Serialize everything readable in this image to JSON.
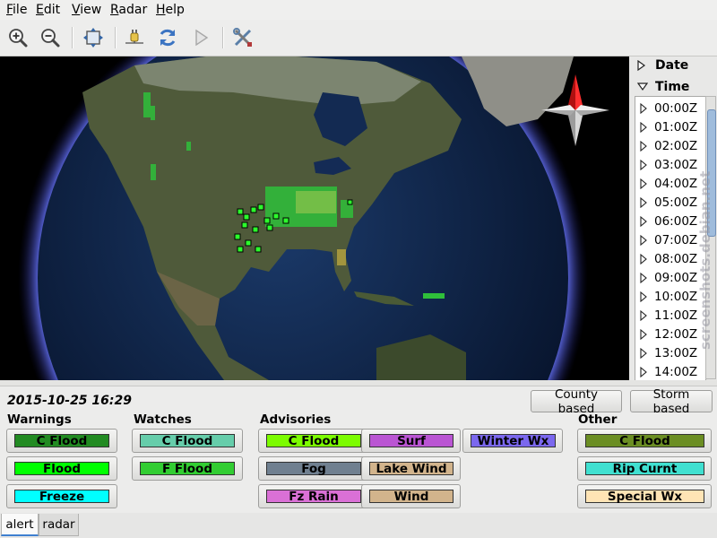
{
  "menubar": {
    "file": "File",
    "edit": "Edit",
    "view": "View",
    "radar": "Radar",
    "help": "Help"
  },
  "sidebar": {
    "date_label": "Date",
    "time_label": "Time",
    "times": [
      "00:00Z",
      "01:00Z",
      "02:00Z",
      "03:00Z",
      "04:00Z",
      "05:00Z",
      "06:00Z",
      "07:00Z",
      "08:00Z",
      "09:00Z",
      "10:00Z",
      "11:00Z",
      "12:00Z",
      "13:00Z",
      "14:00Z"
    ]
  },
  "alerts": {
    "datetime": "2015-10-25 16:29",
    "county_based": "County based",
    "storm_based": "Storm based",
    "warnings": {
      "title": "Warnings",
      "c_flood": "C Flood",
      "flood": "Flood",
      "freeze": "Freeze"
    },
    "watches": {
      "title": "Watches",
      "c_flood": "C Flood",
      "f_flood": "F Flood"
    },
    "advisories": {
      "title": "Advisories",
      "c_flood": "C Flood",
      "surf": "Surf",
      "winter_wx": "Winter Wx",
      "fog": "Fog",
      "lake_wind": "Lake Wind",
      "fz_rain": "Fz Rain",
      "wind": "Wind"
    },
    "other": {
      "title": "Other",
      "c_flood": "C Flood",
      "rip_curnt": "Rip Curnt",
      "special_wx": "Special Wx"
    }
  },
  "colors": {
    "warn_c_flood": "#228b22",
    "warn_flood": "#00ff00",
    "warn_freeze": "#00ffff",
    "watch_c_flood": "#66cdaa",
    "watch_f_flood": "#32cd32",
    "adv_c_flood": "#7cfc00",
    "adv_surf": "#ba55d3",
    "adv_winter_wx": "#7b68ee",
    "adv_fog": "#708090",
    "adv_lake_wind": "#d2b48c",
    "adv_fz_rain": "#da70d6",
    "adv_wind": "#d2b48c",
    "oth_c_flood": "#6b8e23",
    "oth_rip_curnt": "#40e0d0",
    "oth_special_wx": "#ffe4b5"
  },
  "tabs": {
    "alert": "alert",
    "radar": "radar"
  },
  "watermark": "screenshots.debian.net"
}
